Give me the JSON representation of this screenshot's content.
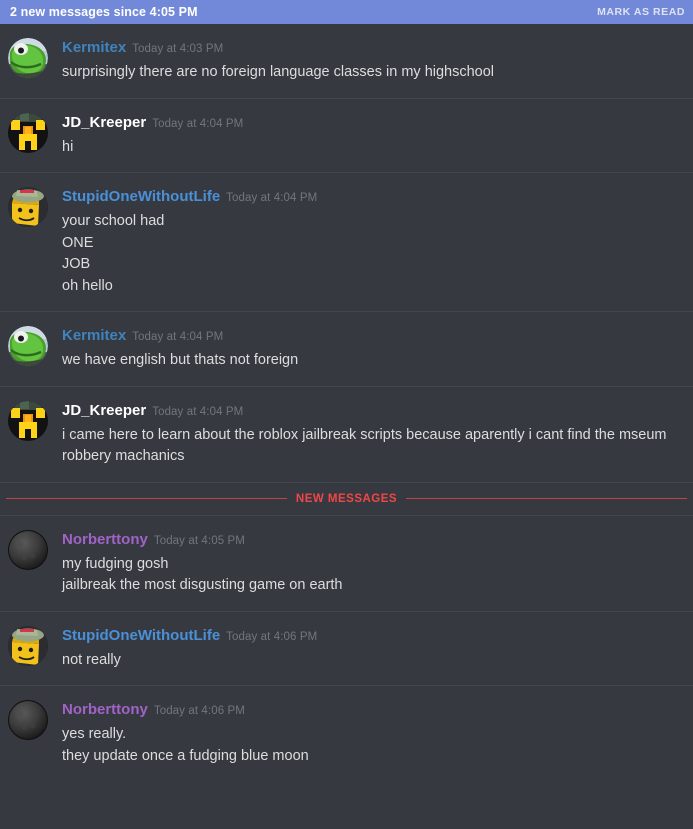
{
  "banner": {
    "text": "2 new messages since 4:05 PM",
    "action_label": "MARK AS READ",
    "background_color": "#7289da",
    "text_color": "#ffffff"
  },
  "theme": {
    "app_background": "#36393f",
    "divider_color": "#42464d",
    "message_text_color": "#dcddde",
    "timestamp_color": "#72767d",
    "new_messages_color": "#f04747"
  },
  "new_messages_divider": {
    "label": "NEW MESSAGES"
  },
  "messages": [
    {
      "author": "Kermitex",
      "author_color": "#3f83bf",
      "timestamp": "Today at 4:03 PM",
      "avatar": "kermit-frog-avatar",
      "lines": [
        "surprisingly there are no foreign language classes in my highschool"
      ]
    },
    {
      "author": "JD_Kreeper",
      "author_color": "#ffffff",
      "timestamp": "Today at 4:04 PM",
      "avatar": "creeper-face-avatar",
      "lines": [
        "hi"
      ]
    },
    {
      "author": "StupidOneWithoutLife",
      "author_color": "#4a90d9",
      "timestamp": "Today at 4:04 PM",
      "avatar": "roblox-head-avatar",
      "lines": [
        "your school had",
        "ONE",
        "JOB",
        "oh hello"
      ]
    },
    {
      "author": "Kermitex",
      "author_color": "#3f83bf",
      "timestamp": "Today at 4:04 PM",
      "avatar": "kermit-frog-avatar",
      "lines": [
        "we have english but thats not foreign"
      ]
    },
    {
      "author": "JD_Kreeper",
      "author_color": "#ffffff",
      "timestamp": "Today at 4:04 PM",
      "avatar": "creeper-face-avatar",
      "lines": [
        "i came here to learn about the roblox jailbreak scripts because aparently i cant find the mseum robbery machanics"
      ]
    },
    {
      "author": "Norberttony",
      "author_color": "#a063c8",
      "timestamp": "Today at 4:05 PM",
      "avatar": "moon-avatar",
      "lines": [
        "my fudging gosh",
        "jailbreak the most disgusting game on earth"
      ]
    },
    {
      "author": "StupidOneWithoutLife",
      "author_color": "#4a90d9",
      "timestamp": "Today at 4:06 PM",
      "avatar": "roblox-head-avatar",
      "lines": [
        "not really"
      ]
    },
    {
      "author": "Norberttony",
      "author_color": "#a063c8",
      "timestamp": "Today at 4:06 PM",
      "avatar": "moon-avatar",
      "lines": [
        "yes really.",
        "they update once a fudging blue moon"
      ]
    }
  ]
}
